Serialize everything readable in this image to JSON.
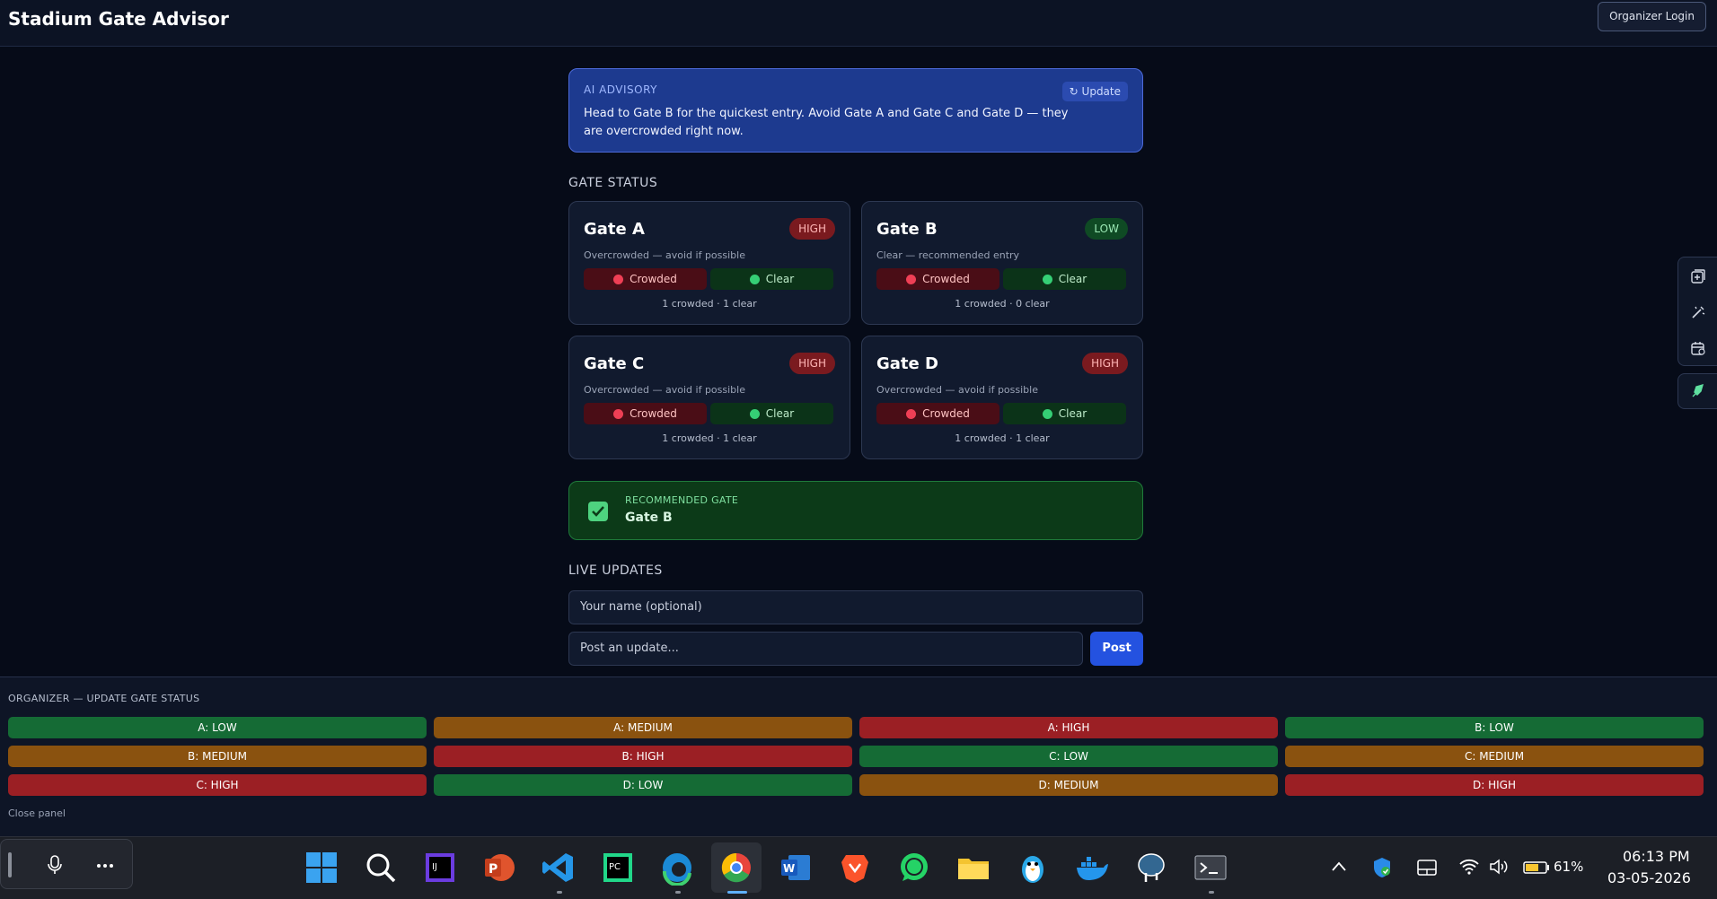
{
  "header": {
    "title": "Stadium Gate Advisor",
    "login_label": "Organizer Login"
  },
  "advisory": {
    "label": "AI ADVISORY",
    "update_label": "↻ Update",
    "text": "Head to Gate B for the quickest entry. Avoid Gate A and Gate C and Gate D — they are overcrowded right now."
  },
  "gate_status": {
    "title": "GATE STATUS",
    "crowded_label": "Crowded",
    "clear_label": "Clear",
    "gates": [
      {
        "name": "Gate A",
        "level": "HIGH",
        "desc": "Overcrowded — avoid if possible",
        "counts": "1 crowded · 1 clear"
      },
      {
        "name": "Gate B",
        "level": "LOW",
        "desc": "Clear — recommended entry",
        "counts": "1 crowded · 0 clear"
      },
      {
        "name": "Gate C",
        "level": "HIGH",
        "desc": "Overcrowded — avoid if possible",
        "counts": "1 crowded · 1 clear"
      },
      {
        "name": "Gate D",
        "level": "HIGH",
        "desc": "Overcrowded — avoid if possible",
        "counts": "1 crowded · 1 clear"
      }
    ]
  },
  "recommended": {
    "label": "RECOMMENDED GATE",
    "gate": "Gate B"
  },
  "live_updates": {
    "title": "LIVE UPDATES",
    "name_placeholder": "Your name (optional)",
    "post_placeholder": "Post an update...",
    "post_label": "Post"
  },
  "organizer": {
    "title": "ORGANIZER — UPDATE GATE STATUS",
    "buttons": [
      {
        "label": "A: LOW",
        "level": "low"
      },
      {
        "label": "A: MEDIUM",
        "level": "medium"
      },
      {
        "label": "A: HIGH",
        "level": "high"
      },
      {
        "label": "B: LOW",
        "level": "low"
      },
      {
        "label": "B: MEDIUM",
        "level": "medium"
      },
      {
        "label": "B: HIGH",
        "level": "high"
      },
      {
        "label": "C: LOW",
        "level": "low"
      },
      {
        "label": "C: MEDIUM",
        "level": "medium"
      },
      {
        "label": "C: HIGH",
        "level": "high"
      },
      {
        "label": "D: LOW",
        "level": "low"
      },
      {
        "label": "D: MEDIUM",
        "level": "medium"
      },
      {
        "label": "D: HIGH",
        "level": "high"
      }
    ],
    "close_label": "Close panel"
  },
  "taskbar": {
    "apps": [
      "windows-start",
      "search",
      "intellij",
      "powerpoint",
      "vscode",
      "pycharm",
      "edge",
      "chrome",
      "word",
      "brave",
      "whatsapp",
      "file-explorer",
      "penguin-app",
      "docker",
      "postgresql",
      "terminal"
    ],
    "battery": "61%",
    "time": "06:13 PM",
    "date": "03-05-2026"
  },
  "colors": {
    "low": "#156b35",
    "medium": "#8a520f",
    "high": "#9b1f24",
    "accent": "#2452e0"
  }
}
